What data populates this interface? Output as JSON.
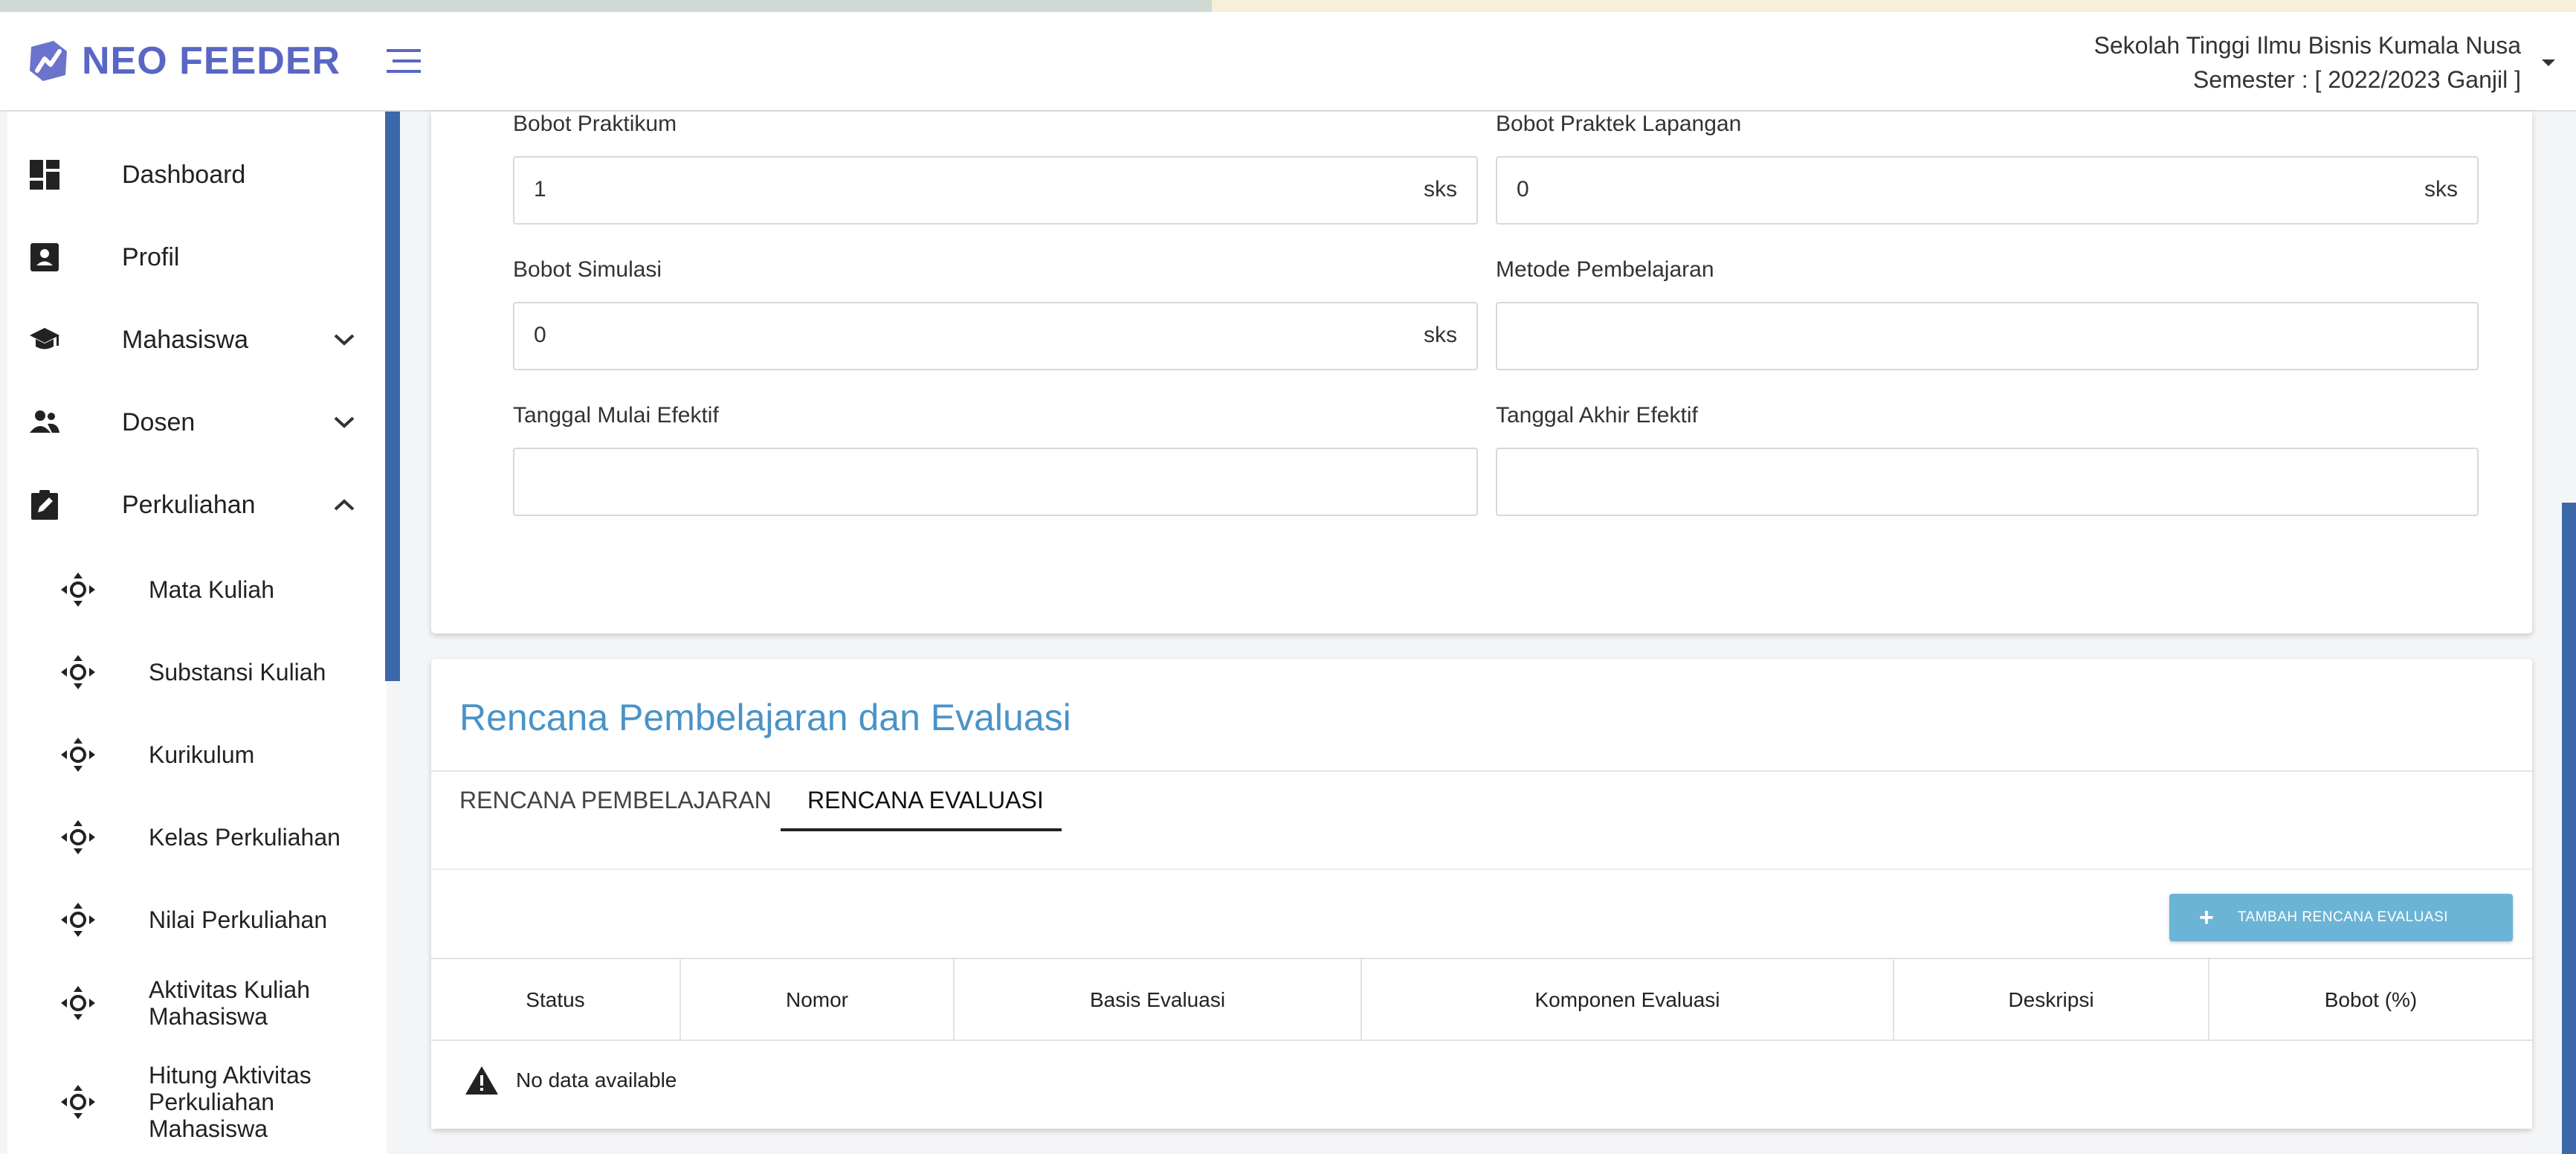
{
  "header": {
    "app_name": "NEO FEEDER",
    "org": "Sekolah Tinggi Ilmu Bisnis Kumala Nusa",
    "semester": "Semester : [ 2022/2023 Ganjil ]"
  },
  "sidebar": {
    "items": [
      {
        "label": "Dashboard",
        "icon": "dashboard-icon"
      },
      {
        "label": "Profil",
        "icon": "profile-card-icon"
      },
      {
        "label": "Mahasiswa",
        "icon": "graduation-cap-icon"
      },
      {
        "label": "Dosen",
        "icon": "people-icon"
      },
      {
        "label": "Perkuliahan",
        "icon": "clipboard-edit-icon"
      }
    ],
    "sub_items": [
      {
        "label": "Mata Kuliah"
      },
      {
        "label": "Substansi Kuliah"
      },
      {
        "label": "Kurikulum"
      },
      {
        "label": "Kelas Perkuliahan"
      },
      {
        "label": "Nilai Perkuliahan"
      },
      {
        "label": "Aktivitas Kuliah Mahasiswa"
      },
      {
        "label": "Hitung Aktivitas Perkuliahan Mahasiswa"
      }
    ]
  },
  "form": {
    "bobot_praktikum": {
      "label": "Bobot Praktikum",
      "value": "1",
      "unit": "sks"
    },
    "bobot_praktek_lapangan": {
      "label": "Bobot Praktek Lapangan",
      "value": "0",
      "unit": "sks"
    },
    "bobot_simulasi": {
      "label": "Bobot Simulasi",
      "value": "0",
      "unit": "sks"
    },
    "metode_pembelajaran": {
      "label": "Metode Pembelajaran",
      "value": ""
    },
    "tanggal_mulai": {
      "label": "Tanggal Mulai Efektif",
      "value": ""
    },
    "tanggal_akhir": {
      "label": "Tanggal Akhir Efektif",
      "value": ""
    }
  },
  "plan": {
    "title": "Rencana Pembelajaran dan Evaluasi",
    "tabs": [
      {
        "label": "RENCANA PEMBELAJARAN"
      },
      {
        "label": "RENCANA EVALUASI"
      }
    ],
    "add_button": "TAMBAH RENCANA EVALUASI",
    "columns": [
      "Status",
      "Nomor",
      "Basis Evaluasi",
      "Komponen Evaluasi",
      "Deskripsi",
      "Bobot (%)"
    ],
    "empty_message": "No data available"
  },
  "colors": {
    "brand": "#5a66c4",
    "accent": "#4a93c8",
    "button": "#6cb4d6",
    "scroll": "#3c67a8"
  }
}
